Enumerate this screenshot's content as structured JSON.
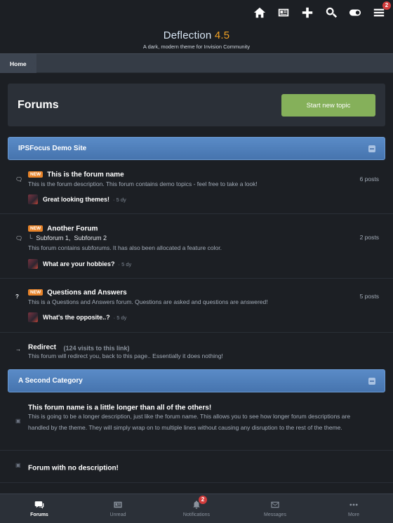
{
  "topbar": {
    "icons": [
      "home-icon",
      "newspaper-icon",
      "plus-icon",
      "search-icon",
      "toggle-icon",
      "menu-icon"
    ],
    "menu_badge": "2"
  },
  "brand": {
    "name": "Deflection",
    "version": "4.5",
    "tagline": "A dark, modern theme for Invision Community",
    "accent": "#f0a023"
  },
  "breadcrumb": {
    "home": "Home"
  },
  "page": {
    "title": "Forums",
    "start_button": "Start new topic",
    "button_color": "#85b05a"
  },
  "categories": [
    {
      "title": "IPSFocus Demo Site",
      "forums": [
        {
          "new": "NEW",
          "name": "This is the forum name",
          "description": "This is the forum description. This forum contains demo topics - feel free to take a look!",
          "posts": "6 posts",
          "last_post": "Great looking themes!",
          "last_time": "5 dy"
        },
        {
          "new": "NEW",
          "name": "Another Forum",
          "subforum1": "Subforum 1,",
          "subforum2": "Subforum 2",
          "description": "This forum contains subforums. It has also been allocated a feature color.",
          "posts": "2 posts",
          "last_post": "What are your hobbies?",
          "last_time": "5 dy"
        },
        {
          "new": "NEW",
          "name": "Questions and Answers",
          "description": "This is a Questions and Answers forum. Questions are asked and questions are answered!",
          "posts": "5 posts",
          "last_post": "What's the opposite..?",
          "last_time": "5 dy"
        },
        {
          "name": "Redirect",
          "visits": "(124 visits to this link)",
          "description": "This forum will redirect you, back to this page.. Essentially it does nothing!"
        }
      ]
    },
    {
      "title": "A Second Category",
      "forums": [
        {
          "name": "This forum name is a little longer than all of the others!",
          "description": "This is going to be a longer description, just like the forum name. This allows you to see how longer forum descriptions are handled by the theme. They will simply wrap on to multiple lines without causing any disruption to the rest of the theme."
        },
        {
          "name": "Forum with no description!"
        }
      ]
    }
  ],
  "bottom_nav": [
    {
      "label": "Forums",
      "icon": "chat-icon",
      "active": true
    },
    {
      "label": "Unread",
      "icon": "newspaper-icon"
    },
    {
      "label": "Notifications",
      "icon": "bell-icon",
      "badge": "2"
    },
    {
      "label": "Messages",
      "icon": "envelope-icon"
    },
    {
      "label": "More",
      "icon": "more-icon"
    }
  ]
}
